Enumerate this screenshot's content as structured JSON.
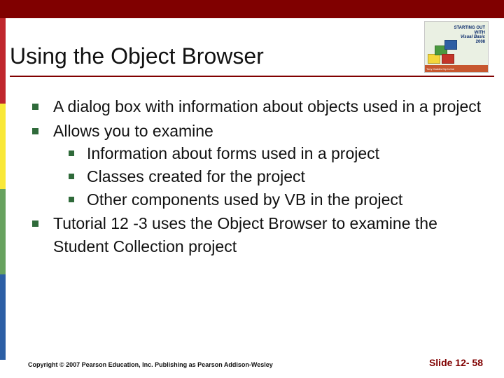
{
  "title": "Using the Object Browser",
  "bullets": {
    "b1": "A dialog box with information about objects used in a project",
    "b2": "Allows you to examine",
    "b2a": "Information about forms used in a project",
    "b2b": "Classes created for the project",
    "b2c": "Other components used by VB in the project",
    "b3": "Tutorial 12 -3 uses the Object Browser to examine the Student Collection project"
  },
  "book": {
    "line1": "STARTING OUT WITH",
    "vb": "Visual Basic",
    "year": "2008",
    "authors": "Tony Gaddis   Kip Irvine"
  },
  "footer": {
    "copyright": "Copyright © 2007 Pearson Education, Inc. Publishing as Pearson Addison-Wesley",
    "slide": "Slide 12- 58"
  }
}
